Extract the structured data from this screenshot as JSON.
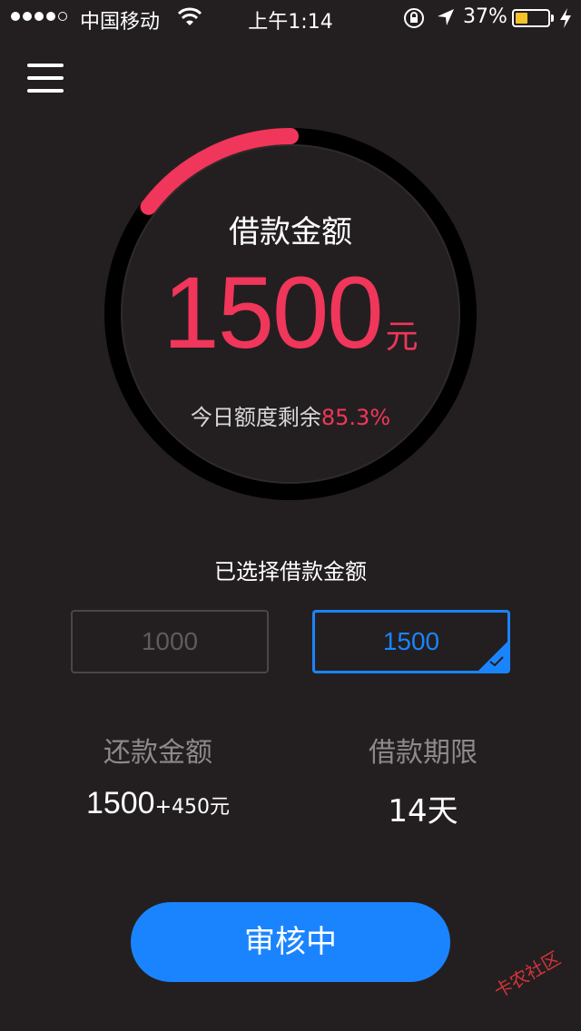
{
  "status_bar": {
    "carrier": "中国移动",
    "time": "上午1:14",
    "battery_percent": "37%",
    "battery_level": 0.37,
    "signal_bars": 4,
    "signal_total": 5,
    "icons": [
      "wifi-icon",
      "orientation-lock-icon",
      "location-icon",
      "charging-icon"
    ]
  },
  "menu": {
    "icon": "menu-icon"
  },
  "gauge": {
    "title": "借款金额",
    "amount": "1500",
    "unit": "元",
    "remaining_label": "今日额度剩余",
    "remaining_value": "85.3%",
    "progress_fraction": 0.147,
    "colors": {
      "track": "#000000",
      "progress": "#f0365a"
    }
  },
  "selection": {
    "label": "已选择借款金额",
    "options": [
      "1000",
      "1500"
    ],
    "selected": "1500"
  },
  "repayment": {
    "label": "还款金额",
    "principal": "1500",
    "extra": "+450元"
  },
  "term": {
    "label": "借款期限",
    "value": "14天"
  },
  "submit": {
    "label": "审核中"
  },
  "watermark": "卡农社区",
  "colors": {
    "background": "#231f20",
    "accent": "#1a84ff",
    "highlight": "#f0365a"
  }
}
